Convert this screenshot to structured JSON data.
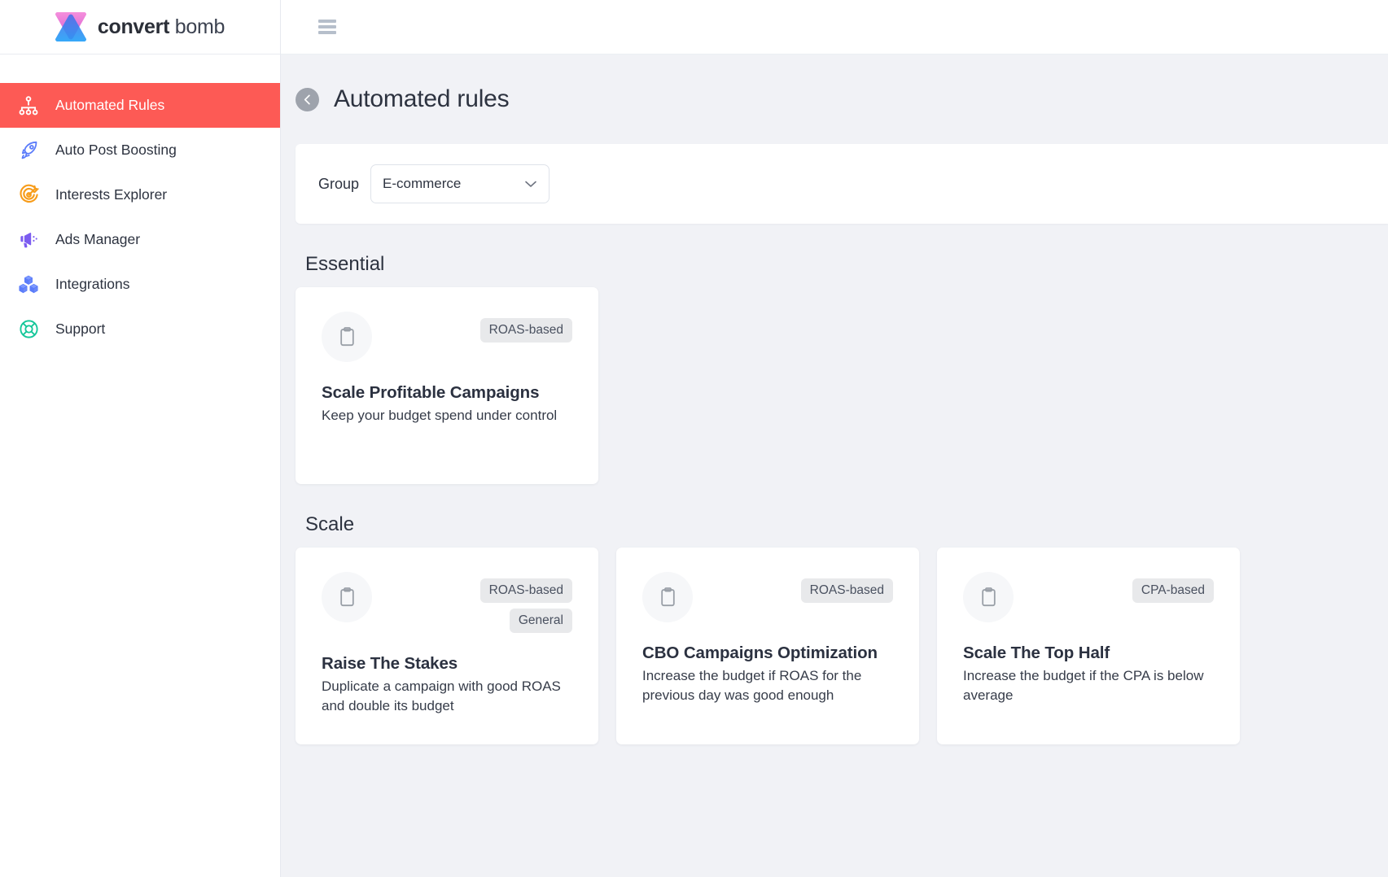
{
  "brand": {
    "name_bold": "convert",
    "name_light": "bomb",
    "logo_icon": "hourglass-logo-icon",
    "colors": {
      "pink": "#f472d0",
      "blue": "#2b9cf6",
      "purple": "#7b4fd6"
    }
  },
  "sidebar": {
    "items": [
      {
        "label": "Automated Rules",
        "icon": "sitemap-icon",
        "active": true,
        "color": "#ffffff"
      },
      {
        "label": "Auto Post Boosting",
        "icon": "rocket-icon",
        "active": false,
        "color": "#5b7cfa"
      },
      {
        "label": "Interests Explorer",
        "icon": "target-icon",
        "active": false,
        "color": "#f79c1a"
      },
      {
        "label": "Ads Manager",
        "icon": "megaphone-icon",
        "active": false,
        "color": "#7c5cf0"
      },
      {
        "label": "Integrations",
        "icon": "blocks-icon",
        "active": false,
        "color": "#5b7cfa"
      },
      {
        "label": "Support",
        "icon": "lifebuoy-icon",
        "active": false,
        "color": "#16c79a"
      }
    ]
  },
  "topbar": {
    "menu_icon": "hamburger-icon"
  },
  "page": {
    "title": "Automated rules",
    "back_icon": "arrow-left-circle-icon"
  },
  "group": {
    "label": "Group",
    "selected": "E-commerce",
    "chevron_icon": "chevron-down-icon"
  },
  "sections": [
    {
      "title": "Essential",
      "cards": [
        {
          "icon": "clipboard-icon",
          "badges": [
            "ROAS-based"
          ],
          "title": "Scale Profitable Campaigns",
          "desc": "Keep your budget spend under control"
        }
      ]
    },
    {
      "title": "Scale",
      "cards": [
        {
          "icon": "clipboard-icon",
          "badges": [
            "ROAS-based",
            "General"
          ],
          "title": "Raise The Stakes",
          "desc": "Duplicate a campaign with good ROAS and double its budget"
        },
        {
          "icon": "clipboard-icon",
          "badges": [
            "ROAS-based"
          ],
          "title": "CBO Campaigns Optimization",
          "desc": "Increase the budget if ROAS for the previous day was good enough"
        },
        {
          "icon": "clipboard-icon",
          "badges": [
            "CPA-based"
          ],
          "title": "Scale The Top Half",
          "desc": "Increase the budget if the CPA is below average"
        }
      ]
    }
  ],
  "theme": {
    "accent": "#fd5a55",
    "content_bg": "#f1f2f6",
    "card_bg": "#ffffff",
    "badge_bg": "#e8e9eb",
    "text": "#2d3340"
  }
}
